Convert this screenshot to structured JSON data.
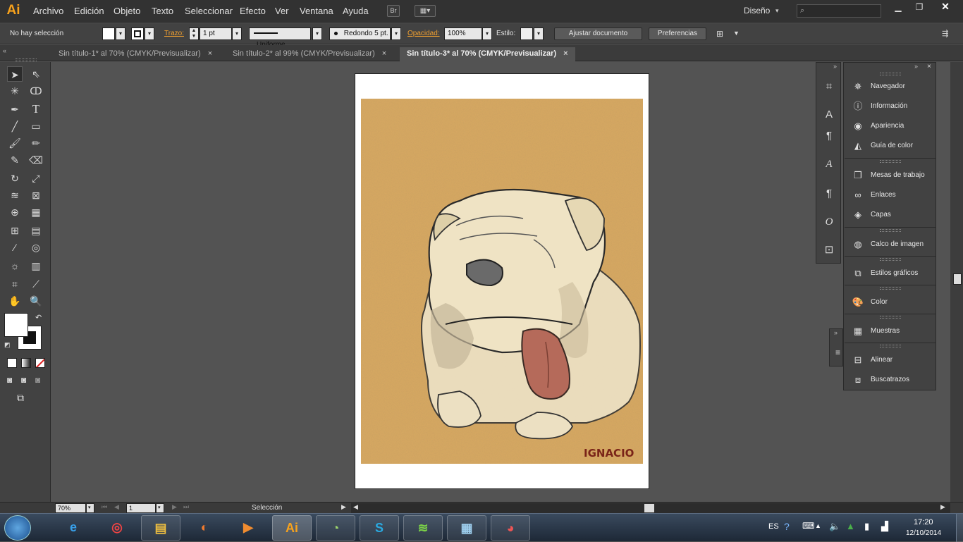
{
  "app": {
    "logo": "Ai"
  },
  "menu": [
    "Archivo",
    "Edición",
    "Objeto",
    "Texto",
    "Seleccionar",
    "Efecto",
    "Ver",
    "Ventana",
    "Ayuda"
  ],
  "workspace": {
    "label": "Diseño"
  },
  "control": {
    "selection": "No hay selección",
    "stroke_label": "Trazo:",
    "stroke_weight": "1 pt",
    "profile": "Uniforme",
    "brush": "Redondo 5 pt.",
    "opacity_label": "Opacidad:",
    "opacity_value": "100%",
    "style_label": "Estilo:",
    "adjust_button": "Ajustar documento",
    "prefs_button": "Preferencias"
  },
  "tabs": [
    {
      "label": "Sin título-1* al 70% (CMYK/Previsualizar)",
      "active": false
    },
    {
      "label": "Sin título-2* al 99% (CMYK/Previsualizar)",
      "active": false
    },
    {
      "label": "Sin título-3* al 70% (CMYK/Previsualizar)",
      "active": true
    }
  ],
  "artwork": {
    "signature": "IGNACIO",
    "paper_color": "#d9a961",
    "tongue_color": "#b56a5a"
  },
  "panels": [
    {
      "icon": "navigator-icon",
      "label": "Navegador"
    },
    {
      "icon": "info-icon",
      "label": "Información"
    },
    {
      "icon": "appearance-icon",
      "label": "Apariencia"
    },
    {
      "icon": "color-guide-icon",
      "label": "Guía de color"
    },
    {
      "icon": "artboards-icon",
      "label": "Mesas de trabajo"
    },
    {
      "icon": "links-icon",
      "label": "Enlaces"
    },
    {
      "icon": "layers-icon",
      "label": "Capas"
    },
    {
      "icon": "image-trace-icon",
      "label": "Calco de imagen"
    },
    {
      "icon": "graphic-styles-icon",
      "label": "Estilos gráficos"
    },
    {
      "icon": "color-icon",
      "label": "Color"
    },
    {
      "icon": "swatches-icon",
      "label": "Muestras"
    },
    {
      "icon": "align-icon",
      "label": "Alinear"
    },
    {
      "icon": "pathfinder-icon",
      "label": "Buscatrazos"
    }
  ],
  "status": {
    "zoom": "70%",
    "page": "1",
    "tool": "Selección"
  },
  "taskbar": {
    "lang": "ES",
    "time": "17:20",
    "date": "12/10/2014"
  }
}
